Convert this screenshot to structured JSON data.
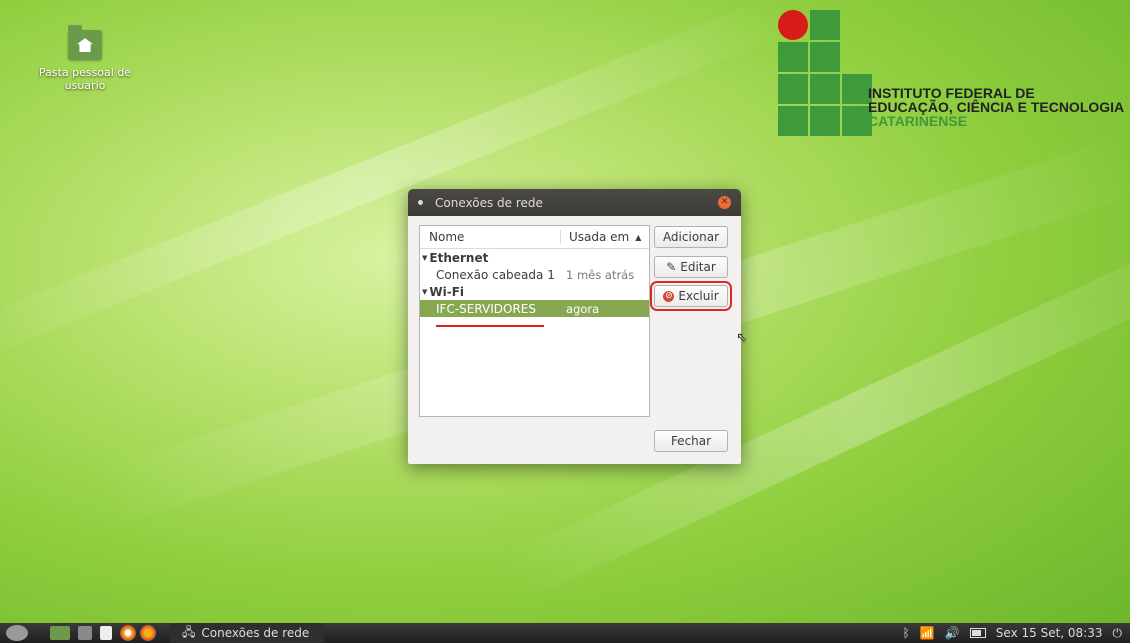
{
  "desktop": {
    "icon_label": "Pasta pessoal de usuario"
  },
  "logo": {
    "line1": "INSTITUTO FEDERAL DE",
    "line2": "EDUCAÇÃO, CIÊNCIA E TECNOLOGIA",
    "line3": "CATARINENSE",
    "colors": {
      "green": "#3e9a3a",
      "red": "#d81a1a"
    }
  },
  "dialog": {
    "title": "Conexões de rede",
    "columns": {
      "name": "Nome",
      "used": "Usada em"
    },
    "groups": [
      {
        "label": "Ethernet",
        "rows": [
          {
            "name": "Conexão cabeada 1",
            "used": "1 mês atrás"
          }
        ]
      },
      {
        "label": "Wi-Fi",
        "rows": [
          {
            "name": "IFC-SERVIDORES",
            "used": "agora",
            "selected": true
          }
        ]
      }
    ],
    "buttons": {
      "add": "Adicionar",
      "edit": "Editar",
      "delete": "Excluir",
      "close": "Fechar"
    }
  },
  "taskbar": {
    "task_label": "Conexões de rede",
    "clock": "Sex 15 Set, 08:33"
  }
}
